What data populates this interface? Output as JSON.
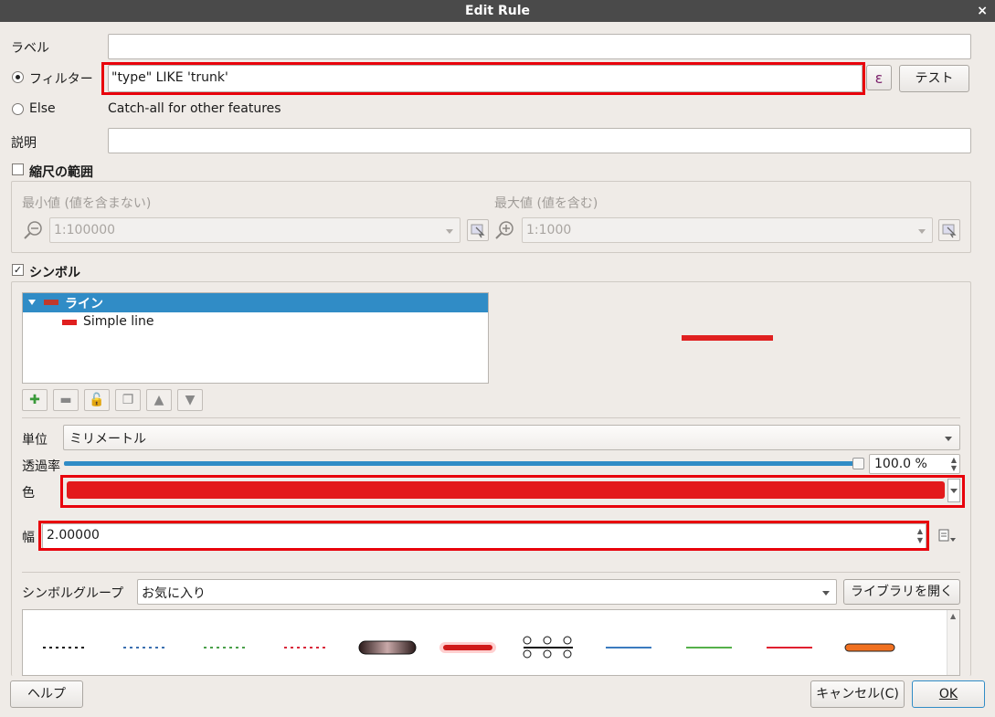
{
  "window": {
    "title": "Edit Rule",
    "close_glyph": "×"
  },
  "label": {
    "text": "ラベル",
    "value": ""
  },
  "filter": {
    "radio_label": "フィルター",
    "value": "\"type\" LIKE 'trunk'",
    "expr_button": "ε",
    "test_button": "テスト",
    "selected": true
  },
  "else": {
    "radio_label": "Else",
    "description": "Catch-all for other features",
    "selected": false
  },
  "description": {
    "text": "説明",
    "value": ""
  },
  "scale": {
    "label": "縮尺の範囲",
    "checked": false,
    "min_label": "最小値 (値を含まない)",
    "min_value": "1:100000",
    "max_label": "最大値 (値を含む)",
    "max_value": "1:1000"
  },
  "symbol": {
    "label": "シンボル",
    "checked": true,
    "tree": [
      {
        "label": "ライン",
        "selected": true,
        "color": "#c0392b"
      },
      {
        "label": "Simple line",
        "selected": false,
        "color": "#e02020"
      }
    ],
    "preview_color": "#e02020",
    "unit_label": "単位",
    "unit_value": "ミリメートル",
    "opacity_label": "透過率",
    "opacity_value": "100.0 %",
    "color_label": "色",
    "color_value": "#e31a1c",
    "width_label": "幅",
    "width_value": "2.00000",
    "group_label": "シンボルグループ",
    "group_value": "お気に入り",
    "library_button": "ライブラリを開く"
  },
  "symbols_list": [
    {
      "name": "black-dotted-line",
      "color": "#111111"
    },
    {
      "name": "blue-dotted-line",
      "color": "#3b6fb0"
    },
    {
      "name": "green-dotted-line",
      "color": "#4aa04a"
    },
    {
      "name": "red-dotted-line",
      "color": "#d9283a"
    },
    {
      "name": "dark-capsule-line",
      "color": "#3a2a2a"
    },
    {
      "name": "red-glow-line",
      "color": "#d01a1a"
    },
    {
      "name": "circle-node-line",
      "color": "#111111"
    },
    {
      "name": "blue-solid-line",
      "color": "#3b7bbf"
    },
    {
      "name": "green-solid-line",
      "color": "#55b04a"
    },
    {
      "name": "red-solid-line",
      "color": "#e02030"
    },
    {
      "name": "orange-outlined-line",
      "color": "#f07020"
    }
  ],
  "footer": {
    "help_button": "ヘルプ",
    "cancel_button": "キャンセル(C)",
    "ok_button": "OK"
  }
}
